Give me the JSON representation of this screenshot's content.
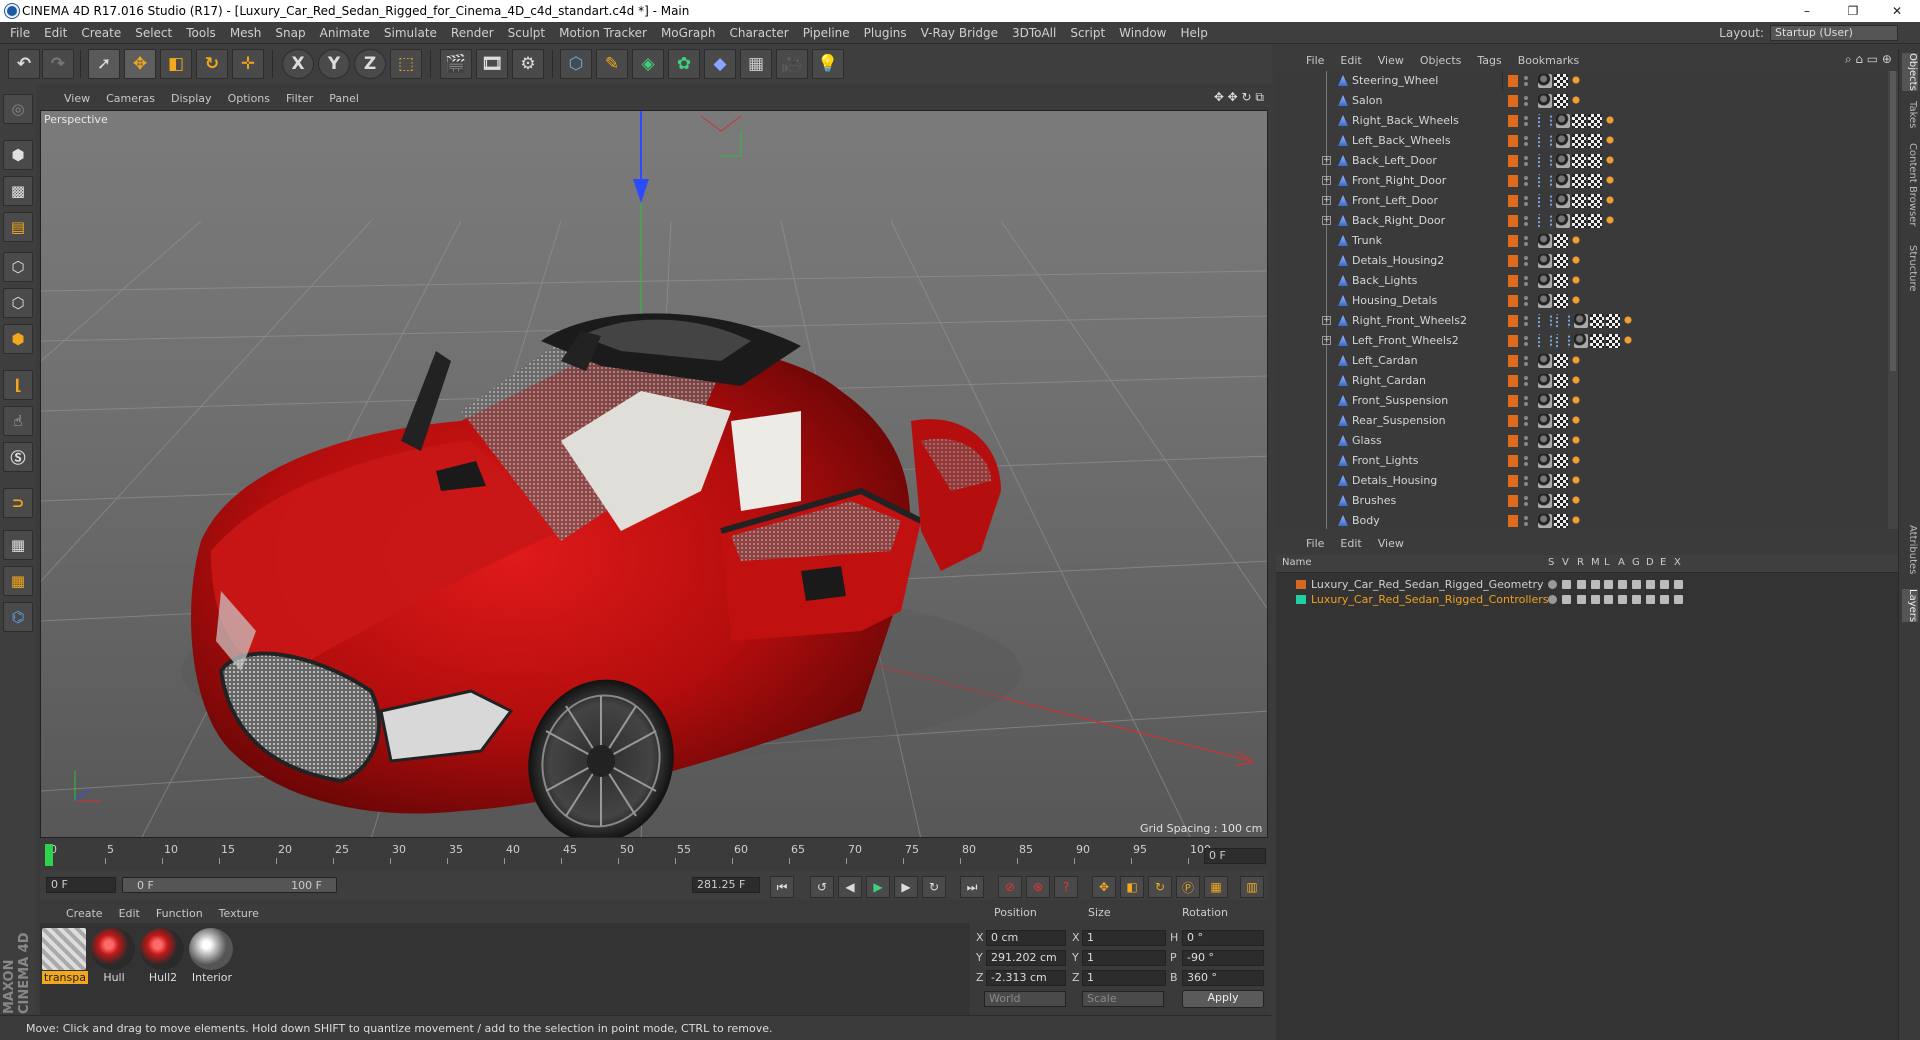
{
  "window": {
    "title": "CINEMA 4D R17.016 Studio (R17) - [Luxury_Car_Red_Sedan_Rigged_for_Cinema_4D_c4d_standart.c4d *] - Main",
    "minimize": "–",
    "maximize": "❐",
    "close": "✕"
  },
  "menubar": {
    "items": [
      "File",
      "Edit",
      "Create",
      "Select",
      "Tools",
      "Mesh",
      "Snap",
      "Animate",
      "Simulate",
      "Render",
      "Sculpt",
      "Motion Tracker",
      "MoGraph",
      "Character",
      "Pipeline",
      "Plugins",
      "V-Ray Bridge",
      "3DToAll",
      "Script",
      "Window",
      "Help"
    ],
    "layout_label": "Layout:",
    "layout_value": "Startup (User)"
  },
  "toolbar": {
    "axis_x": "X",
    "axis_y": "Y",
    "axis_z": "Z"
  },
  "viewport": {
    "menu": [
      "View",
      "Cameras",
      "Display",
      "Options",
      "Filter",
      "Panel"
    ],
    "label": "Perspective",
    "grid_spacing": "Grid Spacing : 100 cm",
    "axis_y": "y",
    "axis_z": "z",
    "axis_x": "x"
  },
  "timeline": {
    "ticks": [
      "0",
      "5",
      "10",
      "15",
      "20",
      "25",
      "30",
      "35",
      "40",
      "45",
      "50",
      "55",
      "60",
      "65",
      "70",
      "75",
      "80",
      "85",
      "90",
      "95",
      "100"
    ],
    "frame_end_field": "0 F",
    "current_frame": "0 F",
    "range_start": "0 F",
    "range_end": "100 F",
    "fps_field": "281.25 F"
  },
  "materials": {
    "menu": [
      "Create",
      "Edit",
      "Function",
      "Texture"
    ],
    "items": [
      {
        "name": "transpa",
        "selected": true
      },
      {
        "name": "Hull",
        "selected": false
      },
      {
        "name": "Hull2",
        "selected": false
      },
      {
        "name": "Interior",
        "selected": false
      }
    ]
  },
  "coordinates": {
    "headers": {
      "position": "Position",
      "size": "Size",
      "rotation": "Rotation"
    },
    "rows": [
      {
        "axis": "X",
        "pos": "0 cm",
        "saxis": "X",
        "size": "1",
        "raxis": "H",
        "rot": "0 °"
      },
      {
        "axis": "Y",
        "pos": "291.202 cm",
        "saxis": "Y",
        "size": "1",
        "raxis": "P",
        "rot": "-90 °"
      },
      {
        "axis": "Z",
        "pos": "-2.313 cm",
        "saxis": "Z",
        "size": "1",
        "raxis": "B",
        "rot": "360 °"
      }
    ],
    "mode_world": "World",
    "mode_scale": "Scale",
    "apply": "Apply"
  },
  "status": {
    "text": "Move: Click and drag to move elements. Hold down SHIFT to quantize movement / add to the selection in point mode, CTRL to remove."
  },
  "objects": {
    "menu": [
      "File",
      "Edit",
      "View",
      "Objects",
      "Tags",
      "Bookmarks"
    ],
    "items": [
      {
        "name": "Steering_Wheel",
        "expand": false,
        "tags": "basic"
      },
      {
        "name": "Salon",
        "expand": false,
        "tags": "basic"
      },
      {
        "name": "Right_Back_Wheels",
        "expand": false,
        "tags": "rig"
      },
      {
        "name": "Left_Back_Wheels",
        "expand": false,
        "tags": "rig"
      },
      {
        "name": "Back_Left_Door",
        "expand": true,
        "tags": "rig"
      },
      {
        "name": "Front_Right_Door",
        "expand": true,
        "tags": "rig"
      },
      {
        "name": "Front_Left_Door",
        "expand": true,
        "tags": "rig"
      },
      {
        "name": "Back_Right_Door",
        "expand": true,
        "tags": "rig"
      },
      {
        "name": "Trunk",
        "expand": false,
        "tags": "basic"
      },
      {
        "name": "Detals_Housing2",
        "expand": false,
        "tags": "basic"
      },
      {
        "name": "Back_Lights",
        "expand": false,
        "tags": "basic"
      },
      {
        "name": "Housing_Detals",
        "expand": false,
        "tags": "basic"
      },
      {
        "name": "Right_Front_Wheels2",
        "expand": true,
        "tags": "rig2"
      },
      {
        "name": "Left_Front_Wheels2",
        "expand": true,
        "tags": "rig2"
      },
      {
        "name": "Left_Cardan",
        "expand": false,
        "tags": "basic"
      },
      {
        "name": "Right_Cardan",
        "expand": false,
        "tags": "basic"
      },
      {
        "name": "Front_Suspension",
        "expand": false,
        "tags": "basic"
      },
      {
        "name": "Rear_Suspension",
        "expand": false,
        "tags": "basic"
      },
      {
        "name": "Glass",
        "expand": false,
        "tags": "basic"
      },
      {
        "name": "Front_Lights",
        "expand": false,
        "tags": "basic"
      },
      {
        "name": "Detals_Housing",
        "expand": false,
        "tags": "basic"
      },
      {
        "name": "Brushes",
        "expand": false,
        "tags": "basic"
      },
      {
        "name": "Body",
        "expand": false,
        "tags": "basic"
      }
    ]
  },
  "layers": {
    "menu": [
      "File",
      "Edit",
      "View"
    ],
    "headers": [
      "Name",
      "S",
      "V",
      "R",
      "M",
      "L",
      "A",
      "G",
      "D",
      "E",
      "X"
    ],
    "items": [
      {
        "name": "Luxury_Car_Red_Sedan_Rigged_Geometry",
        "color": "#d2691e",
        "text_color": "#cfcfcf"
      },
      {
        "name": "Luxury_Car_Red_Sedan_Rigged_Controllers",
        "color": "#1fd1a0",
        "text_color": "#f0a020"
      }
    ]
  },
  "side_tabs": [
    "Objects",
    "Takes",
    "Content Browser",
    "Structure",
    "Attributes",
    "Layers"
  ],
  "brand": "MAXON CINEMA 4D"
}
